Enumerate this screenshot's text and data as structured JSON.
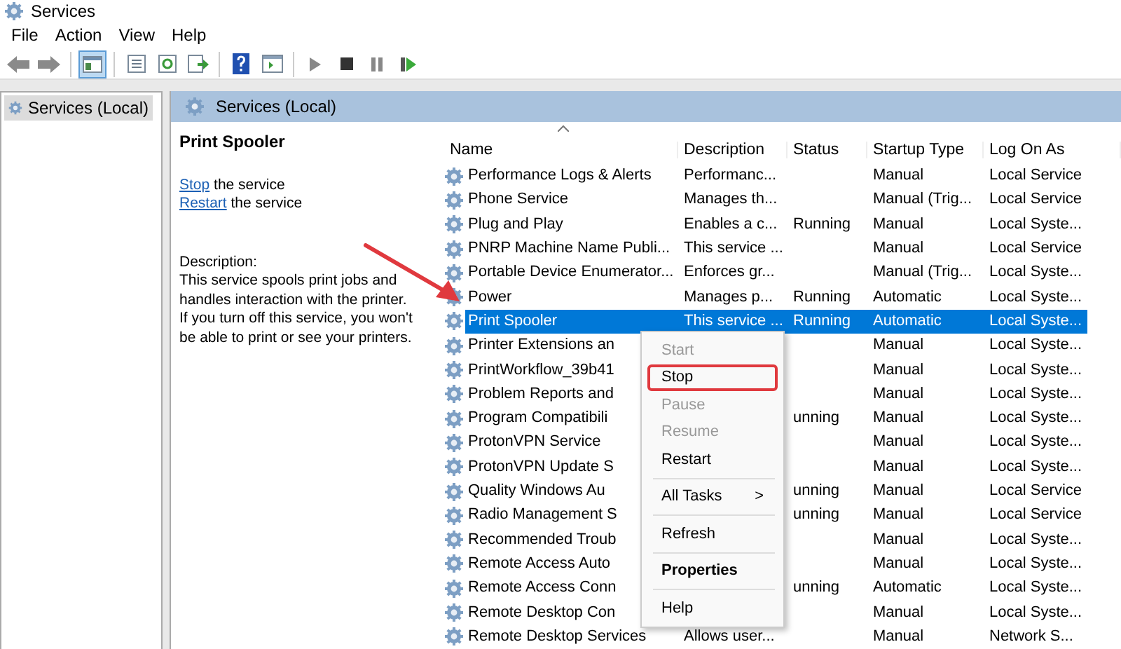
{
  "window": {
    "title": "Services"
  },
  "menu_bar": [
    "File",
    "Action",
    "View",
    "Help"
  ],
  "toolbar": [
    {
      "buttons": [
        {
          "kind": "back",
          "selected": false
        },
        {
          "kind": "forward",
          "selected": false
        }
      ]
    },
    {
      "buttons": [
        {
          "kind": "tree",
          "selected": true
        }
      ]
    },
    {
      "buttons": [
        {
          "kind": "properties",
          "selected": false
        },
        {
          "kind": "refresh",
          "selected": false
        },
        {
          "kind": "export",
          "selected": false
        }
      ]
    },
    {
      "buttons": [
        {
          "kind": "help",
          "selected": false
        },
        {
          "kind": "console",
          "selected": false
        }
      ]
    },
    {
      "buttons": [
        {
          "kind": "play",
          "selected": false
        },
        {
          "kind": "stop",
          "selected": false
        },
        {
          "kind": "pause",
          "selected": false
        },
        {
          "kind": "resume",
          "selected": false
        }
      ]
    }
  ],
  "tree": [
    {
      "label": "Services (Local)",
      "selected": true
    }
  ],
  "pane_header": "Services (Local)",
  "details": {
    "title": "Print Spooler",
    "actions": [
      {
        "link": "Stop",
        "text": "the service"
      },
      {
        "link": "Restart",
        "text": "the service"
      }
    ],
    "description_label": "Description:",
    "description": "This service spools print jobs and handles interaction with the printer. If you turn off this service, you won't be able to print or see your printers."
  },
  "table": {
    "columns": [
      "Name",
      "Description",
      "Status",
      "Startup Type",
      "Log On As"
    ],
    "rows": [
      {
        "name": "Performance Logs & Alerts",
        "description": "Performanc...",
        "status": "",
        "startup_type": "Manual",
        "log_on_as": "Local Service",
        "selected": false
      },
      {
        "name": "Phone Service",
        "description": "Manages th...",
        "status": "",
        "startup_type": "Manual (Trig...",
        "log_on_as": "Local Service",
        "selected": false
      },
      {
        "name": "Plug and Play",
        "description": "Enables a c...",
        "status": "Running",
        "startup_type": "Manual",
        "log_on_as": "Local Syste...",
        "selected": false
      },
      {
        "name": "PNRP Machine Name Publi...",
        "description": "This service ...",
        "status": "",
        "startup_type": "Manual",
        "log_on_as": "Local Service",
        "selected": false
      },
      {
        "name": "Portable Device Enumerator...",
        "description": "Enforces gr...",
        "status": "",
        "startup_type": "Manual (Trig...",
        "log_on_as": "Local Syste...",
        "selected": false
      },
      {
        "name": "Power",
        "description": "Manages p...",
        "status": "Running",
        "startup_type": "Automatic",
        "log_on_as": "Local Syste...",
        "selected": false
      },
      {
        "name": "Print Spooler",
        "description": "This service ...",
        "status": "Running",
        "startup_type": "Automatic",
        "log_on_as": "Local Syste...",
        "selected": true
      },
      {
        "name": "Printer Extensions an",
        "description": "",
        "status": "",
        "startup_type": "Manual",
        "log_on_as": "Local Syste...",
        "selected": false
      },
      {
        "name": "PrintWorkflow_39b41",
        "description": "",
        "status": "",
        "startup_type": "Manual",
        "log_on_as": "Local Syste...",
        "selected": false
      },
      {
        "name": "Problem Reports and",
        "description": "",
        "status": "",
        "startup_type": "Manual",
        "log_on_as": "Local Syste...",
        "selected": false
      },
      {
        "name": "Program Compatibili",
        "description": "",
        "status": "unning",
        "startup_type": "Manual",
        "log_on_as": "Local Syste...",
        "selected": false
      },
      {
        "name": "ProtonVPN Service",
        "description": "",
        "status": "",
        "startup_type": "Manual",
        "log_on_as": "Local Syste...",
        "selected": false
      },
      {
        "name": "ProtonVPN Update S",
        "description": "",
        "status": "",
        "startup_type": "Manual",
        "log_on_as": "Local Syste...",
        "selected": false
      },
      {
        "name": "Quality Windows Au",
        "description": "",
        "status": "unning",
        "startup_type": "Manual",
        "log_on_as": "Local Service",
        "selected": false
      },
      {
        "name": "Radio Management S",
        "description": "",
        "status": "unning",
        "startup_type": "Manual",
        "log_on_as": "Local Service",
        "selected": false
      },
      {
        "name": "Recommended Troub",
        "description": "",
        "status": "",
        "startup_type": "Manual",
        "log_on_as": "Local Syste...",
        "selected": false
      },
      {
        "name": "Remote Access Auto",
        "description": "",
        "status": "",
        "startup_type": "Manual",
        "log_on_as": "Local Syste...",
        "selected": false
      },
      {
        "name": "Remote Access Conn",
        "description": "",
        "status": "unning",
        "startup_type": "Automatic",
        "log_on_as": "Local Syste...",
        "selected": false
      },
      {
        "name": "Remote Desktop Con",
        "description": "",
        "status": "",
        "startup_type": "Manual",
        "log_on_as": "Local Syste...",
        "selected": false
      },
      {
        "name": "Remote Desktop Services",
        "description": "Allows user...",
        "status": "",
        "startup_type": "Manual",
        "log_on_as": "Network S...",
        "selected": false
      }
    ]
  },
  "context_menu": [
    {
      "kind": "item",
      "label": "Start",
      "disabled": true,
      "highlighted": false
    },
    {
      "kind": "item",
      "label": "Stop",
      "disabled": false,
      "highlighted": true
    },
    {
      "kind": "item",
      "label": "Pause",
      "disabled": true,
      "highlighted": false
    },
    {
      "kind": "item",
      "label": "Resume",
      "disabled": true,
      "highlighted": false
    },
    {
      "kind": "item",
      "label": "Restart",
      "disabled": false,
      "highlighted": false
    },
    {
      "kind": "separator"
    },
    {
      "kind": "submenu",
      "label": "All Tasks",
      "submenu_mark": ">",
      "disabled": false,
      "highlighted": false
    },
    {
      "kind": "separator"
    },
    {
      "kind": "item",
      "label": "Refresh",
      "disabled": false,
      "highlighted": false
    },
    {
      "kind": "separator"
    },
    {
      "kind": "default",
      "label": "Properties",
      "disabled": false,
      "highlighted": false
    },
    {
      "kind": "separator"
    },
    {
      "kind": "item",
      "label": "Help",
      "disabled": false,
      "highlighted": false
    }
  ]
}
